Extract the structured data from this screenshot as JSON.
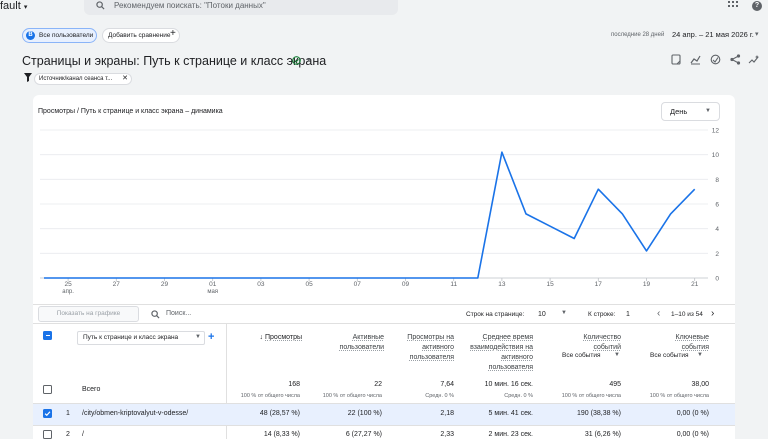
{
  "topbar": {
    "account": "fault",
    "search_placeholder": "Рекомендуем поискать: \"Потоки данных\"",
    "help": "?"
  },
  "segments": {
    "badge": "В",
    "all_users": "Все пользователи",
    "add_compare": "Добавить сравнение",
    "add_icon": "+"
  },
  "daterange": {
    "label": "последние 28 дней",
    "value": "24 апр. – 21 мая 2026 г."
  },
  "page": {
    "title": "Страницы и экраны: Путь к странице и класс экрана"
  },
  "filter": {
    "chip": "Источник/канал сеанса т..."
  },
  "chart": {
    "title": "Просмотры / Путь к странице и класс экрана – динамика",
    "granularity": "День"
  },
  "chart_data": {
    "type": "line",
    "title": "Просмотры / Путь к странице и класс экрана – динамика",
    "xlabel": "",
    "ylabel": "",
    "ylim": [
      0,
      12
    ],
    "yticks": [
      0,
      2,
      4,
      6,
      8,
      10,
      12
    ],
    "xticks": [
      {
        "day": 1,
        "label": "25",
        "sub": "апр."
      },
      {
        "day": 3,
        "label": "27",
        "sub": ""
      },
      {
        "day": 5,
        "label": "29",
        "sub": ""
      },
      {
        "day": 7,
        "label": "01",
        "sub": "мая"
      },
      {
        "day": 9,
        "label": "03",
        "sub": ""
      },
      {
        "day": 11,
        "label": "05",
        "sub": ""
      },
      {
        "day": 13,
        "label": "07",
        "sub": ""
      },
      {
        "day": 15,
        "label": "09",
        "sub": ""
      },
      {
        "day": 17,
        "label": "11",
        "sub": ""
      },
      {
        "day": 19,
        "label": "13",
        "sub": ""
      },
      {
        "day": 21,
        "label": "15",
        "sub": ""
      },
      {
        "day": 23,
        "label": "17",
        "sub": ""
      },
      {
        "day": 25,
        "label": "19",
        "sub": ""
      },
      {
        "day": 27,
        "label": "21",
        "sub": ""
      }
    ],
    "x": [
      "24 апр.",
      "25 апр.",
      "26 апр.",
      "27 апр.",
      "28 апр.",
      "29 апр.",
      "30 апр.",
      "01 мая",
      "02 мая",
      "03 мая",
      "04 мая",
      "05 мая",
      "06 мая",
      "07 мая",
      "08 мая",
      "09 мая",
      "10 мая",
      "11 мая",
      "12 мая",
      "13 мая",
      "14 мая",
      "15 мая",
      "16 мая",
      "17 мая",
      "18 мая",
      "19 мая",
      "20 мая",
      "21 мая"
    ],
    "series": [
      {
        "values": [
          0,
          0,
          0,
          0,
          0,
          0,
          0,
          0,
          0,
          0,
          0,
          0,
          0,
          0,
          0,
          0,
          0,
          0,
          0,
          10.2,
          5.2,
          4.2,
          3.2,
          7.2,
          5.2,
          2.2,
          5.2,
          7.2
        ],
        "color": "#1a73e8"
      }
    ],
    "grid": true
  },
  "table_controls": {
    "show_on_chart": "Показать на графике",
    "search_placeholder": "Поиск...",
    "rows_per_page_label": "Строк на странице:",
    "rows_per_page": "10",
    "to_row_label": "К строке:",
    "to_row": "1",
    "range": "1–10 из 54"
  },
  "table": {
    "dimension_header": "Путь к странице и класс экрана",
    "columns": [
      {
        "label": "Просмотры",
        "sorted": true
      },
      {
        "label": "Активные пользователи"
      },
      {
        "label": "Просмотры на активного пользователя"
      },
      {
        "label": "Среднее время взаимодействия на активного пользователя"
      },
      {
        "label": "Количество событий",
        "dropdown": "Все события"
      },
      {
        "label": "Ключевые события",
        "dropdown": "Все события"
      }
    ],
    "totals": {
      "label": "Всего",
      "values": [
        "168",
        "22",
        "7,64",
        "10 мин. 16 сек.",
        "495",
        "38,00"
      ],
      "subs": [
        "100 % от общего числа",
        "100 % от общего числа",
        "Средн. 0 %",
        "Средн. 0 %",
        "100 % от общего числа",
        "100 % от общего числа"
      ]
    },
    "rows": [
      {
        "num": "1",
        "path": "/city/obmen-kriptovalyut-v-odesse/",
        "checked": true,
        "values": [
          "48 (28,57 %)",
          "22 (100 %)",
          "2,18",
          "5 мин. 41 сек.",
          "190 (38,38 %)",
          "0,00 (0 %)"
        ]
      },
      {
        "num": "2",
        "path": "/",
        "checked": false,
        "values": [
          "14 (8,33 %)",
          "6 (27,27 %)",
          "2,33",
          "2 мин. 23 сек.",
          "31 (6,26 %)",
          "0,00 (0 %)"
        ]
      }
    ]
  }
}
